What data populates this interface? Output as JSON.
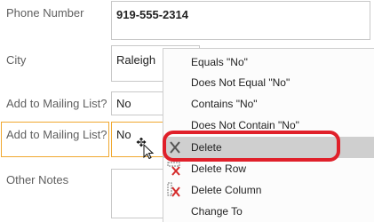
{
  "form": {
    "phone_label": "Phone Number",
    "phone_value": "919-555-2314",
    "city_label": "City",
    "city_value": "Raleigh",
    "mailing1_label": "Add to Mailing List?",
    "mailing1_value": "No",
    "mailing2_label": "Add to Mailing List?",
    "mailing2_value": "No",
    "notes_label": "Other Notes",
    "notes_value": ""
  },
  "context_menu": {
    "items": [
      {
        "label": "Equals \"No\"",
        "icon": ""
      },
      {
        "label": "Does Not Equal \"No\"",
        "icon": ""
      },
      {
        "label": "Contains \"No\"",
        "icon": ""
      },
      {
        "label": "Does Not Contain \"No\"",
        "icon": ""
      },
      {
        "label": "Delete",
        "icon": "delete-x-icon"
      },
      {
        "label": "Delete Row",
        "icon": "delete-row-icon"
      },
      {
        "label": "Delete Column",
        "icon": "delete-column-icon"
      },
      {
        "label": "Change To",
        "icon": ""
      }
    ],
    "hovered_index": 4
  },
  "colors": {
    "selection_border": "#f0a830",
    "highlight_ring": "#e0202a",
    "hover_bg": "#cfcfcf",
    "icon_red": "#d42a2a"
  }
}
